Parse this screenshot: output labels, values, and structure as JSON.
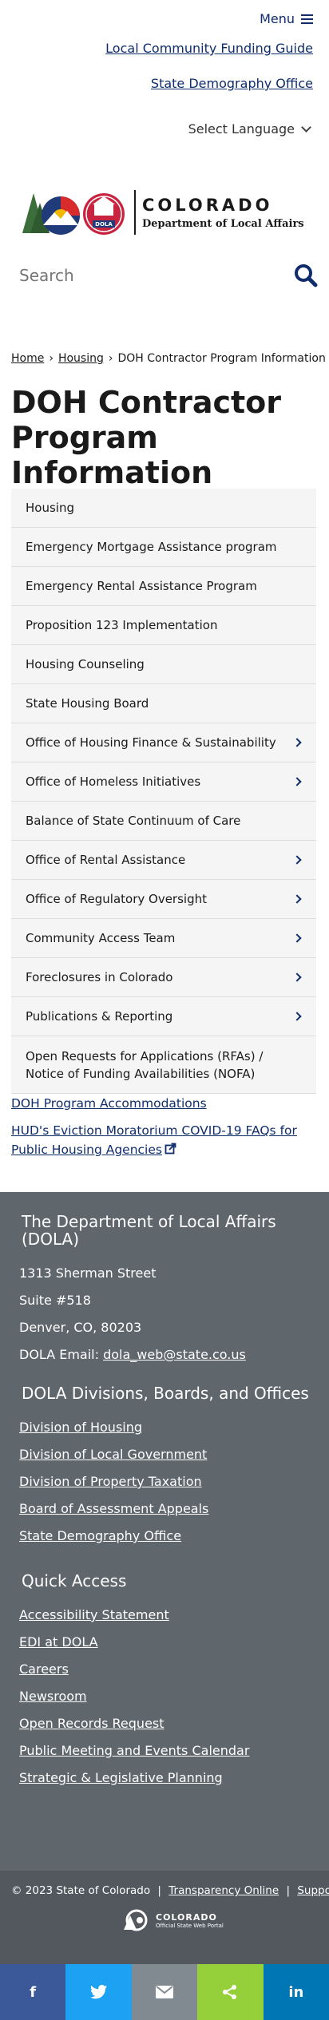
{
  "header": {
    "menu_label": "Menu",
    "util_links": [
      "Local Community Funding Guide",
      "State Demography Office"
    ],
    "language_label": "Select Language",
    "logo_title": "COLORADO",
    "logo_subtitle": "Department of Local Affairs",
    "logo_badge": "DOLA"
  },
  "search": {
    "placeholder": "Search"
  },
  "breadcrumb": {
    "home": "Home",
    "sep": "›",
    "parent": "Housing",
    "current": "DOH Contractor Program Information"
  },
  "page_title": "DOH Contractor Program Information",
  "nav_items": [
    "Housing",
    "Emergency Mortgage Assistance program",
    "Emergency Rental Assistance Program",
    "Proposition 123 Implementation",
    "Housing Counseling",
    "State Housing Board",
    "Office of Housing Finance & Sustainability",
    "Office of Homeless Initiatives",
    "Balance of State Continuum of Care",
    "Office of Rental Assistance",
    "Office of Regulatory Oversight",
    "Community Access Team",
    "Foreclosures in Colorado",
    "Publications & Reporting",
    "Open Requests for Applications (RFAs) / Notice of Funding Availabilities (NOFA)"
  ],
  "extra_links": [
    "DOH Program Accommodations",
    "HUD's Eviction Moratorium COVID-19 FAQs for Public Housing Agencies"
  ],
  "footer": {
    "org_heading": "The Department of Local Affairs (DOLA)",
    "address1": "1313 Sherman Street",
    "address2": "Suite  #518",
    "address3": "Denver, CO, 80203",
    "email_label": "DOLA Email: ",
    "email": "dola_web@state.co.us",
    "divisions_heading": "DOLA Divisions, Boards, and Offices",
    "divisions": [
      "Division of Housing",
      "Division of Local Government",
      "Division of Property Taxation",
      "Board of Assessment Appeals",
      "State Demography Office"
    ],
    "quick_heading": "Quick Access",
    "quick_links": [
      "Accessibility Statement",
      "EDI at DOLA",
      "Careers",
      "Newsroom",
      "Open Records Request",
      "Public Meeting and Events Calendar",
      "Strategic & Legislative Planning"
    ]
  },
  "bottom": {
    "copyright": "© 2023 State of Colorado",
    "sep": "|",
    "transparency": "Transparency Online",
    "support": "Support",
    "portal_title": "COLORADO",
    "portal_subtitle": "Official State Web Portal"
  },
  "share": {
    "facebook": "f",
    "linkedin": "in",
    "colors": {
      "facebook": "#3b5998",
      "twitter": "#1da1f2",
      "email": "#818a91",
      "share": "#95d03a",
      "linkedin": "#0077b5"
    }
  },
  "colors": {
    "brand_blue": "#0f2d6b",
    "footer_bg": "#5f666c",
    "bottom_bg": "#52585e",
    "nav_bg": "#f5f5f5"
  }
}
